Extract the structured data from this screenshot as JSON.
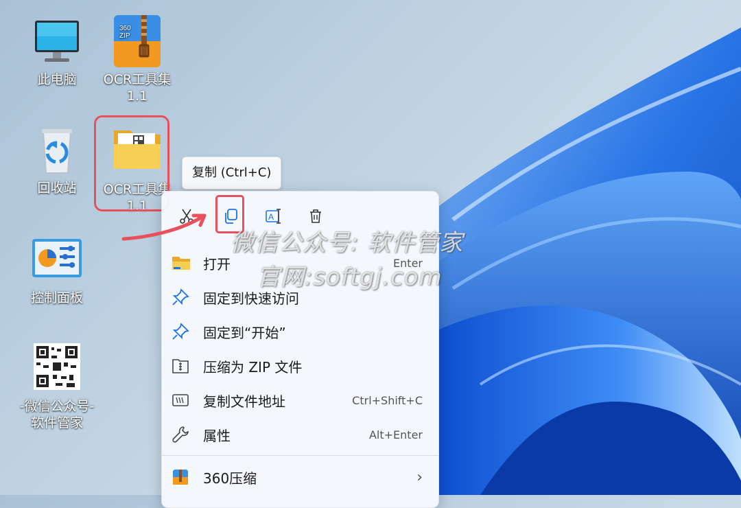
{
  "desktop": {
    "icons": [
      {
        "label_line1": "此电脑",
        "label_line2": ""
      },
      {
        "label_line1": "OCR工具集",
        "label_line2": "1.1"
      },
      {
        "label_line1": "回收站",
        "label_line2": ""
      },
      {
        "label_line1": "OCR工具集",
        "label_line2": "1.1"
      },
      {
        "label_line1": "控制面板",
        "label_line2": ""
      },
      {
        "label_line1": "-微信公众号-",
        "label_line2": "软件管家"
      }
    ],
    "zip_badge": "360",
    "zip_badge2": "ZIP"
  },
  "tooltip": {
    "text": "复制 (Ctrl+C)"
  },
  "context_menu": {
    "items": [
      {
        "label": "打开",
        "shortcut": "Enter"
      },
      {
        "label": "固定到快速访问",
        "shortcut": ""
      },
      {
        "label": "固定到“开始”",
        "shortcut": ""
      },
      {
        "label": "压缩为 ZIP 文件",
        "shortcut": ""
      },
      {
        "label": "复制文件地址",
        "shortcut": "Ctrl+Shift+C"
      },
      {
        "label": "属性",
        "shortcut": "Alt+Enter"
      },
      {
        "label": "360压缩",
        "shortcut": ""
      }
    ],
    "submenu_arrow": "›"
  },
  "watermark": {
    "line1": "微信公众号: 软件管家",
    "line2": "官网:softgj.com"
  },
  "colors": {
    "highlight": "#e8505b",
    "accent": "#1a73e8"
  }
}
